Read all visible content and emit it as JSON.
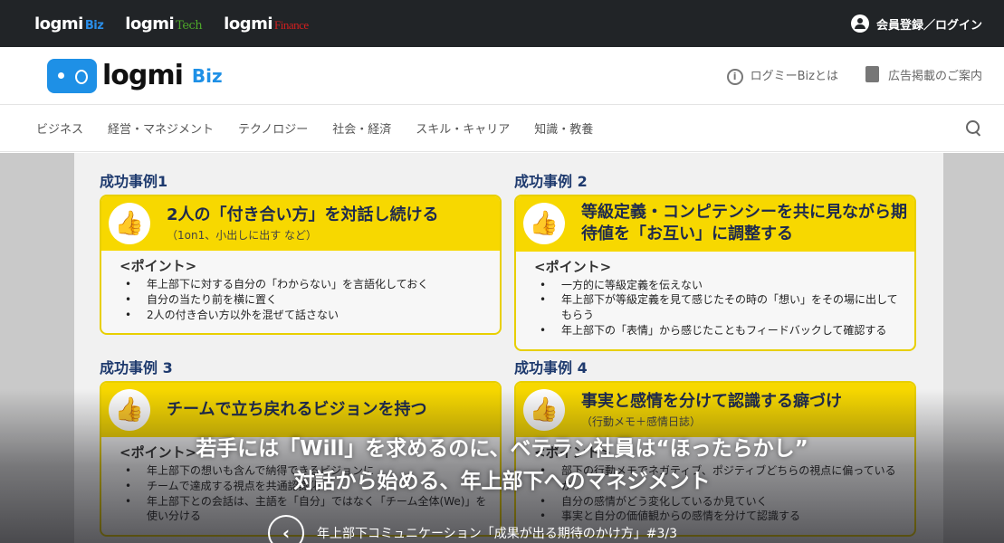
{
  "topbar": {
    "brands": [
      {
        "name": "logmi",
        "sub": "Biz",
        "color": "#2a8ee8"
      },
      {
        "name": "logmi",
        "sub": "Tech",
        "color": "#4ea82a"
      },
      {
        "name": "logmi",
        "sub": "Finance",
        "color": "#d21f1f"
      }
    ],
    "login": "会員登録／ログイン"
  },
  "header": {
    "logo_word": "logmi",
    "logo_sub": "Biz",
    "links": [
      "ログミーBizとは",
      "広告掲載のご案内"
    ]
  },
  "nav": {
    "items": [
      "ビジネス",
      "経営・マネジメント",
      "テクノロジー",
      "社会・経済",
      "スキル・キャリア",
      "知識・教養"
    ]
  },
  "slide": {
    "point_label": "<ポイント>",
    "cases": [
      {
        "label": "成功事例1",
        "title": "2人の「付き合い方」を対話し続ける",
        "sub": "（1on1、小出しに出す など）",
        "points": [
          "年上部下に対する自分の「わからない」を言語化しておく",
          "自分の当たり前を横に置く",
          "2人の付き合い方以外を混ぜて話さない"
        ]
      },
      {
        "label": "成功事例 2",
        "title": "等級定義・コンピテンシーを共に見ながら期待値を「お互い」に調整する",
        "sub": "",
        "points": [
          "一方的に等級定義を伝えない",
          "年上部下が等級定義を見て感じたその時の「想い」をその場に出してもらう",
          "年上部下の「表情」から感じたこともフィードバックして確認する"
        ]
      },
      {
        "label": "成功事例 3",
        "title": "チームで立ち戻れるビジョンを持つ",
        "sub": "",
        "points": [
          "年上部下の想いも含んで納得できるビジョンに",
          "チームで達成する視点を共通認識化",
          "年上部下との会話は、主語を「自分」ではなく「チーム全体(We)」を使い分ける"
        ]
      },
      {
        "label": "成功事例 4",
        "title": "事実と感情を分けて認識する癖づけ",
        "sub": "（行動メモ＋感情日誌）",
        "points": [
          "部下の行動メモでネガティブ、ポジティブどちらの視点に偏っているか",
          "自分の感情がどう変化しているか見ていく",
          "事実と自分の価値観からの感情を分けて認識する"
        ]
      }
    ]
  },
  "hero": {
    "headline_1": "若手には「Will」を求めるのに、ベテラン社員は“ほったらかし”",
    "headline_2": "対話から始める、年上部下へのマネジメント",
    "series": "年上部下コミュニケーション「成果が出る期待のかけ方」#3/3"
  }
}
